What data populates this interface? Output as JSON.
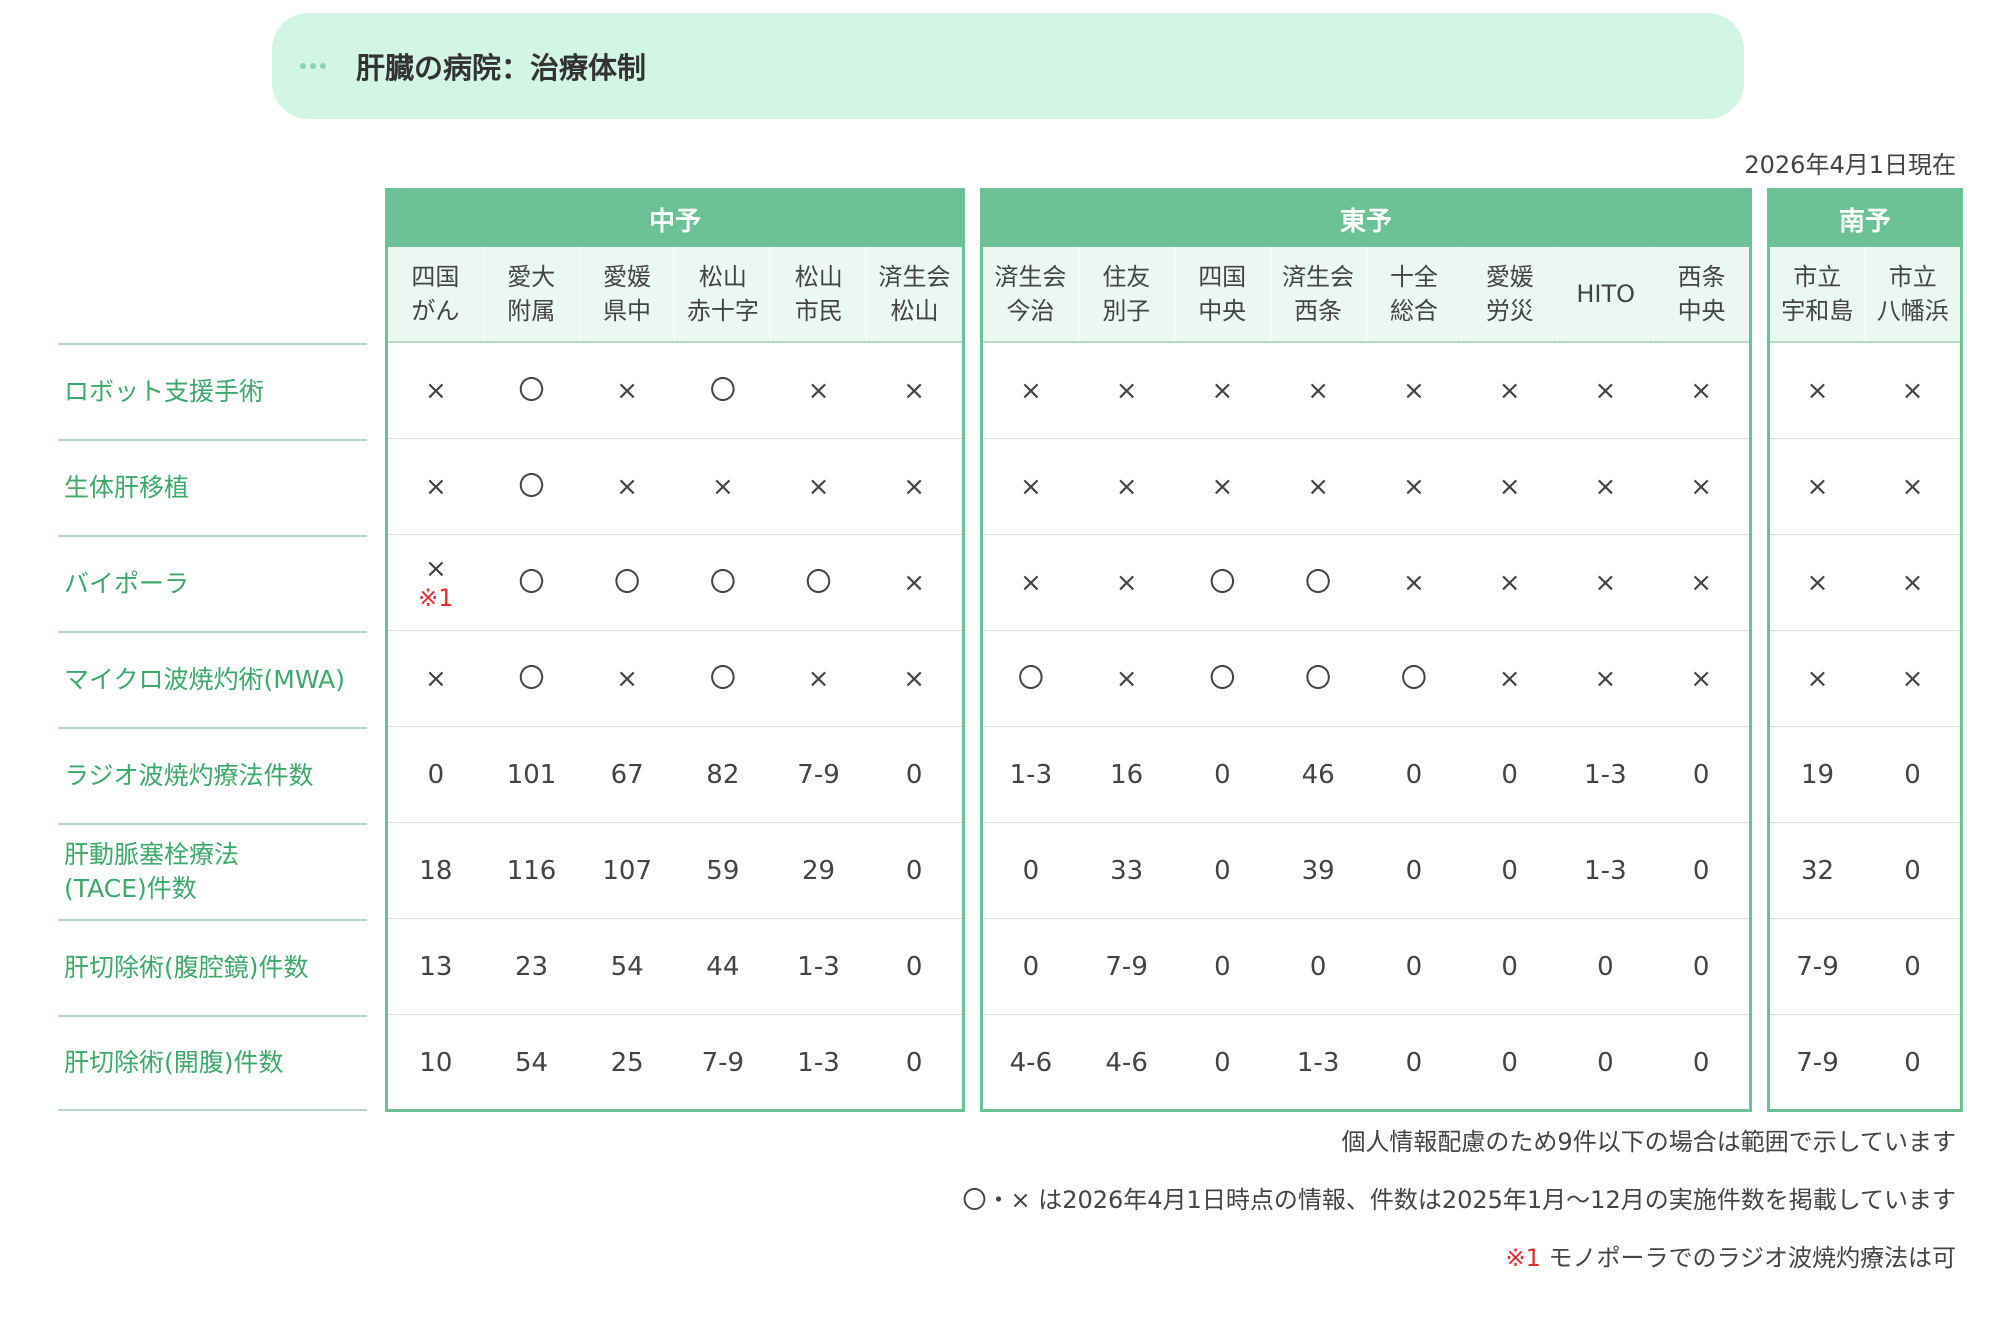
{
  "title": "肝臓の病院：治療体制",
  "as_of": "2026年4月1日現在",
  "rows": [
    "ロボット支援手術",
    "生体肝移植",
    "バイポーラ",
    "マイクロ波焼灼術(MWA)",
    "ラジオ波焼灼療法件数",
    "肝動脈塞栓療法\n(TACE)件数",
    "肝切除術(腹腔鏡)件数",
    "肝切除術(開腹)件数"
  ],
  "regions": [
    {
      "name": "中予",
      "hospitals": [
        "四国\nがん",
        "愛大\n附属",
        "愛媛\n県中",
        "松山\n赤十字",
        "松山\n市民",
        "済生会\n松山"
      ],
      "values": [
        [
          "×",
          "〇",
          "×",
          "〇",
          "×",
          "×"
        ],
        [
          "×",
          "〇",
          "×",
          "×",
          "×",
          "×"
        ],
        [
          "×",
          "〇",
          "〇",
          "〇",
          "〇",
          "×"
        ],
        [
          "×",
          "〇",
          "×",
          "〇",
          "×",
          "×"
        ],
        [
          "0",
          "101",
          "67",
          "82",
          "7-9",
          "0"
        ],
        [
          "18",
          "116",
          "107",
          "59",
          "29",
          "0"
        ],
        [
          "13",
          "23",
          "54",
          "44",
          "1-3",
          "0"
        ],
        [
          "10",
          "54",
          "25",
          "7-9",
          "1-3",
          "0"
        ]
      ]
    },
    {
      "name": "東予",
      "hospitals": [
        "済生会\n今治",
        "住友\n別子",
        "四国\n中央",
        "済生会\n西条",
        "十全\n総合",
        "愛媛\n労災",
        "HITO",
        "西条\n中央"
      ],
      "values": [
        [
          "×",
          "×",
          "×",
          "×",
          "×",
          "×",
          "×",
          "×"
        ],
        [
          "×",
          "×",
          "×",
          "×",
          "×",
          "×",
          "×",
          "×"
        ],
        [
          "×",
          "×",
          "〇",
          "〇",
          "×",
          "×",
          "×",
          "×"
        ],
        [
          "〇",
          "×",
          "〇",
          "〇",
          "〇",
          "×",
          "×",
          "×"
        ],
        [
          "1-3",
          "16",
          "0",
          "46",
          "0",
          "0",
          "1-3",
          "0"
        ],
        [
          "0",
          "33",
          "0",
          "39",
          "0",
          "0",
          "1-3",
          "0"
        ],
        [
          "0",
          "7-9",
          "0",
          "0",
          "0",
          "0",
          "0",
          "0"
        ],
        [
          "4-6",
          "4-6",
          "0",
          "1-3",
          "0",
          "0",
          "0",
          "0"
        ]
      ]
    },
    {
      "name": "南予",
      "hospitals": [
        "市立\n宇和島",
        "市立\n八幡浜"
      ],
      "values": [
        [
          "×",
          "×"
        ],
        [
          "×",
          "×"
        ],
        [
          "×",
          "×"
        ],
        [
          "×",
          "×"
        ],
        [
          "19",
          "0"
        ],
        [
          "32",
          "0"
        ],
        [
          "7-9",
          "0"
        ],
        [
          "7-9",
          "0"
        ]
      ]
    }
  ],
  "cell_note": "※1",
  "footnotes": {
    "line1": "個人情報配慮のため9件以下の場合は範囲で示しています",
    "line2": "〇・× は2026年4月1日時点の情報、件数は2025年1月～12月の実施件数を掲載しています",
    "note_mark": "※1",
    "note_text": " モノポーラでのラジオ波焼灼療法は可"
  },
  "colors": {
    "accent": "#6cc296",
    "banner": "#d2f5e5",
    "label": "#3ea86d",
    "note": "#e03030"
  }
}
